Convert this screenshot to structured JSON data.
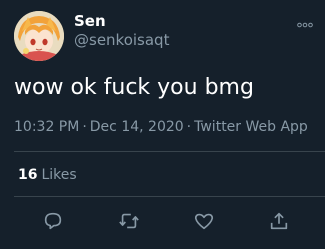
{
  "tweet": {
    "author": {
      "display_name": "Sen",
      "handle": "@senkoisaqt",
      "avatar_icon": "anime-avatar"
    },
    "text": "wow ok fuck you bmg",
    "time": "10:32 PM",
    "date": "Dec 14, 2020",
    "separator": "·",
    "source": "Twitter Web App",
    "likes_count": "16",
    "likes_label": "Likes"
  },
  "actions": [
    {
      "name": "reply",
      "icon": "reply-icon"
    },
    {
      "name": "retweet",
      "icon": "retweet-icon"
    },
    {
      "name": "like",
      "icon": "heart-icon"
    },
    {
      "name": "share",
      "icon": "share-icon"
    }
  ],
  "colors": {
    "background": "#15202b",
    "primary_text": "#ffffff",
    "secondary_text": "#8899a6",
    "divider": "#38444d"
  }
}
